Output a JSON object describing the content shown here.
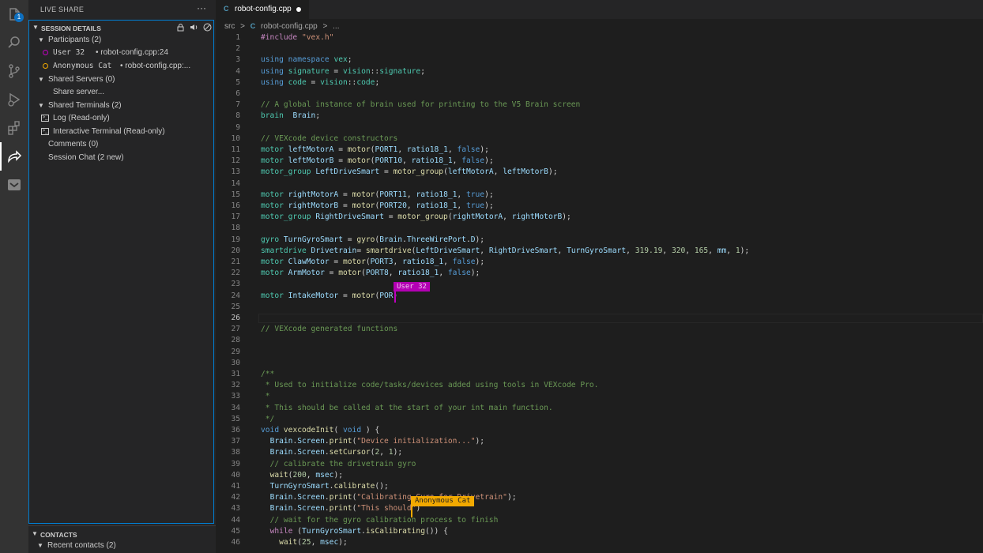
{
  "activity_bar": {
    "items": [
      {
        "icon": "files-icon",
        "badge": "1"
      },
      {
        "icon": "search-icon"
      },
      {
        "icon": "source-control-icon"
      },
      {
        "icon": "run-debug-icon"
      },
      {
        "icon": "extensions-icon"
      },
      {
        "icon": "live-share-icon",
        "active": true
      },
      {
        "icon": "inbox-icon"
      }
    ]
  },
  "sidebar": {
    "title": "LIVE SHARE",
    "more": "···",
    "session_details": "SESSION DETAILS",
    "participants": "Participants (2)",
    "users": [
      {
        "name": "User 32",
        "location": "• robot-config.cpp:24",
        "color": "#c000c0"
      },
      {
        "name": "Anonymous Cat",
        "location": "• robot-config.cpp:...",
        "color": "#f2a900"
      }
    ],
    "shared_servers": "Shared Servers (0)",
    "share_server": "Share server...",
    "shared_terminals": "Shared Terminals (2)",
    "terminals": [
      "Log (Read-only)",
      "Interactive Terminal (Read-only)"
    ],
    "comments": "Comments (0)",
    "session_chat": "Session Chat (2 new)",
    "contacts": "CONTACTS",
    "recent_contacts": "Recent contacts (2)"
  },
  "editor": {
    "tab": {
      "label": "robot-config.cpp",
      "modified": true
    },
    "breadcrumb": [
      "src",
      ">",
      "robot-config.cpp",
      ">",
      "..."
    ],
    "current_line": 26,
    "cursors": [
      {
        "name": "User 32",
        "line": 24,
        "color": "#b300b3"
      },
      {
        "name": "Anonymous Cat",
        "line": 43,
        "color": "#f2a900"
      }
    ]
  }
}
